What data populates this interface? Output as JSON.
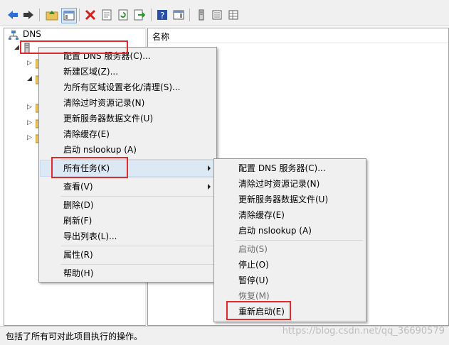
{
  "tree": {
    "root_label": "DNS"
  },
  "list_header": {
    "name_column": "名称"
  },
  "context_menu": {
    "items": [
      {
        "label": "配置 DNS 服务器(C)..."
      },
      {
        "label": "新建区域(Z)..."
      },
      {
        "label": "为所有区域设置老化/清理(S)..."
      },
      {
        "label": "清除过时资源记录(N)"
      },
      {
        "label": "更新服务器数据文件(U)"
      },
      {
        "label": "清除缓存(E)"
      },
      {
        "label": "启动 nslookup (A)"
      },
      {
        "label": "所有任务(K)"
      },
      {
        "label": "查看(V)"
      },
      {
        "label": "删除(D)"
      },
      {
        "label": "刷新(F)"
      },
      {
        "label": "导出列表(L)..."
      },
      {
        "label": "属性(R)"
      },
      {
        "label": "帮助(H)"
      }
    ]
  },
  "submenu": {
    "items": [
      {
        "label": "配置 DNS 服务器(C)..."
      },
      {
        "label": "清除过时资源记录(N)"
      },
      {
        "label": "更新服务器数据文件(U)"
      },
      {
        "label": "清除缓存(E)"
      },
      {
        "label": "启动 nslookup (A)"
      },
      {
        "label": "启动(S)"
      },
      {
        "label": "停止(O)"
      },
      {
        "label": "暂停(U)"
      },
      {
        "label": "恢复(M)"
      },
      {
        "label": "重新启动(E)"
      }
    ]
  },
  "status": {
    "text": "包括了所有可对此项目执行的操作。"
  },
  "watermark": "https://blog.csdn.net/qq_36690579",
  "colors": {
    "highlight": "#dde8f5",
    "annotation_red": "#e02b2b",
    "menu_bg": "#f0f0f0",
    "disabled_text": "#6d6d6d"
  }
}
